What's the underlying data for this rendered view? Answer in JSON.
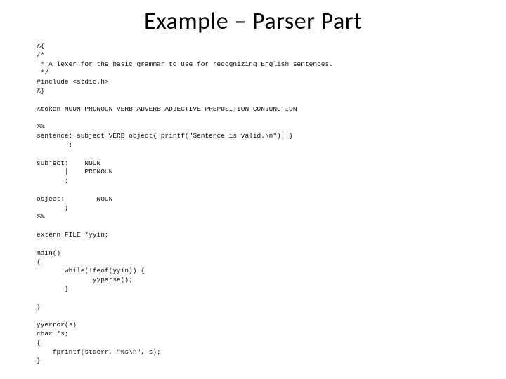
{
  "title": "Example – Parser Part",
  "code": {
    "l01": "%{",
    "l02": "/*",
    "l03": " * A lexer for the basic grammar to use for recognizing English sentences.",
    "l04": " */",
    "l05": "#include <stdio.h>",
    "l06": "%}",
    "l07": "",
    "l08": "%token NOUN PRONOUN VERB ADVERB ADJECTIVE PREPOSITION CONJUNCTION",
    "l09": "",
    "l10": "%%",
    "l11": "sentence: subject VERB object{ printf(\"Sentence is valid.\\n\"); }",
    "l12": "        ;",
    "l13": "",
    "l14": "subject:    NOUN",
    "l15": "       |    PRONOUN",
    "l16": "       ;",
    "l17": "",
    "l18": "object:        NOUN",
    "l19": "       ;",
    "l20": "%%",
    "l21": "",
    "l22": "extern FILE *yyin;",
    "l23": "",
    "l24": "main()",
    "l25": "{",
    "l26": "       while(!feof(yyin)) {",
    "l27": "              yyparse();",
    "l28": "       }",
    "l29": "",
    "l30": "}",
    "l31": "",
    "l32": "yyerror(s)",
    "l33": "char *s;",
    "l34": "{",
    "l35": "    fprintf(stderr, \"%s\\n\", s);",
    "l36": "}"
  }
}
